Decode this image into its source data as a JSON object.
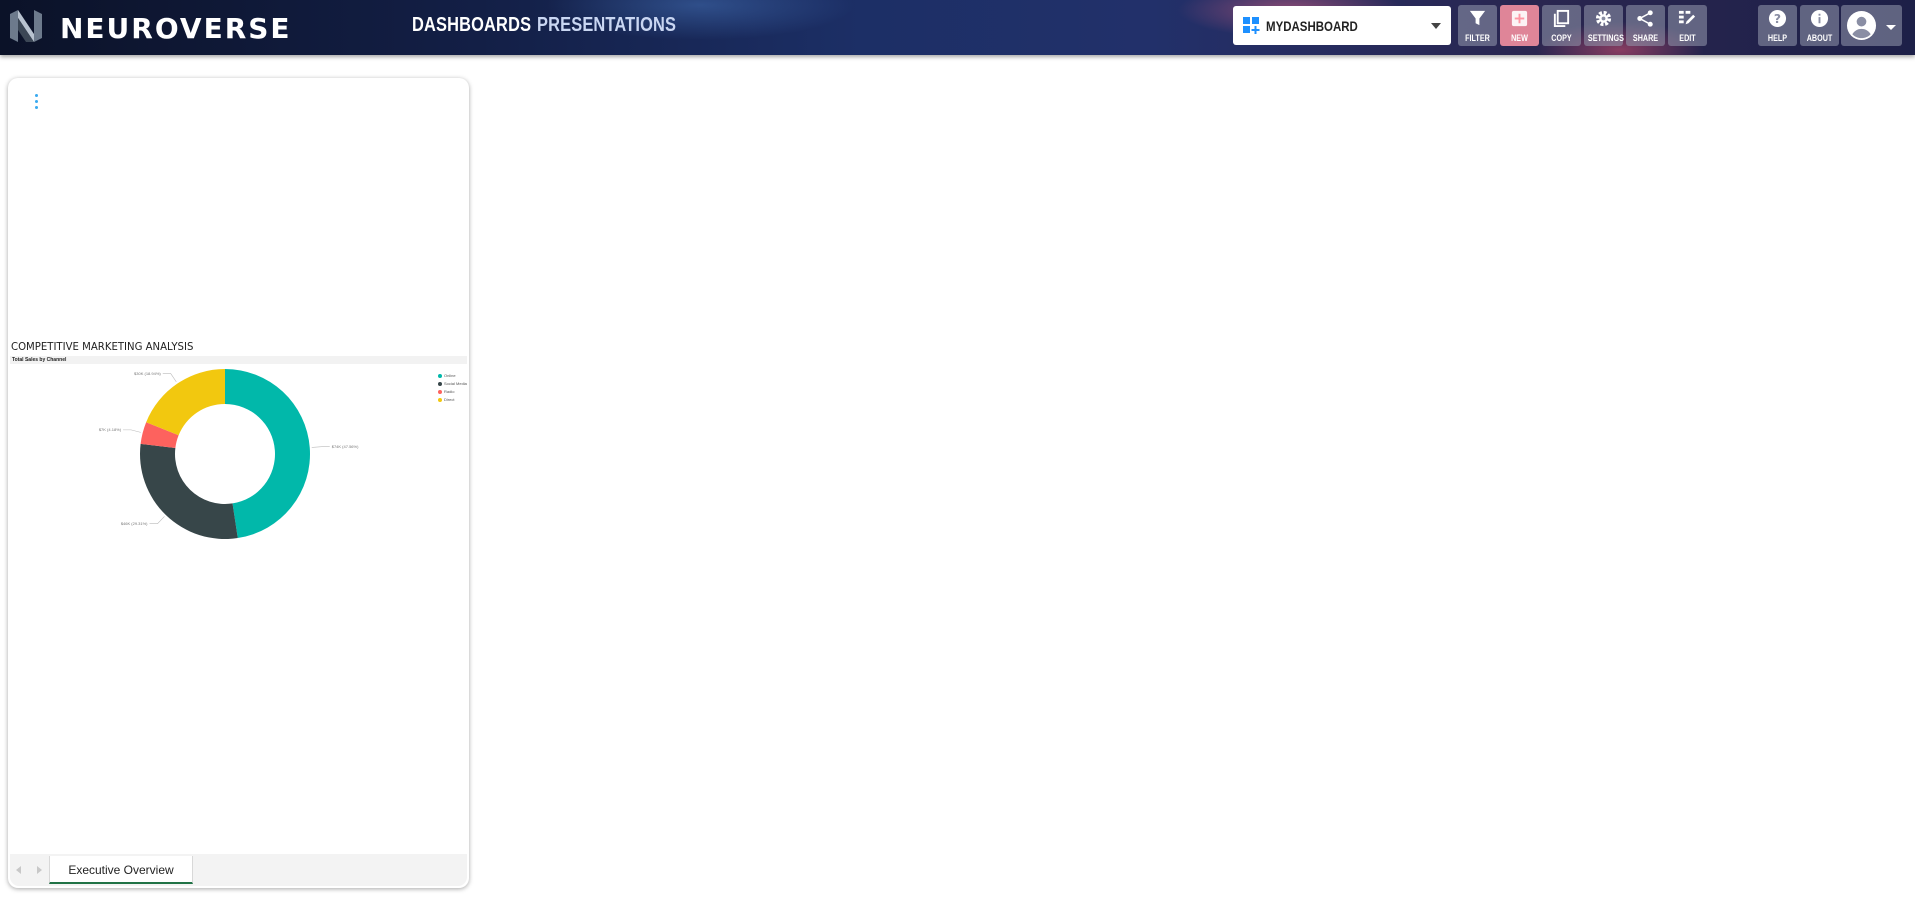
{
  "app": {
    "brand": "NEUROVERSE",
    "nav": {
      "dashboards": "DASHBOARDS",
      "presentations": "PRESENTATIONS"
    },
    "dashboard_select": {
      "value": "MYDASHBOARD"
    },
    "toolbar": {
      "filter": "FILTER",
      "new": "NEW",
      "copy": "COPY",
      "settings": "SETTINGS",
      "share": "SHARE",
      "edit": "EDIT",
      "help": "HELP",
      "about": "ABOUT"
    },
    "colors": {
      "accent": "#1e90ff",
      "new_button": "#ff96a5",
      "tab_underline": "#217346"
    }
  },
  "card": {
    "report_title": "COMPETITIVE MARKETING ANALYSIS",
    "visual_title": "Total Sales by Channel",
    "sheet_tab": "Executive Overview"
  },
  "chart_data": {
    "type": "pie",
    "title": "Total Sales by Channel",
    "donut": true,
    "categories": [
      "Online",
      "Social Media",
      "Radio",
      "Direct"
    ],
    "values": [
      47.6,
      29.3,
      4.2,
      18.9
    ],
    "labels": [
      "$74K (47.56%)",
      "$46K (29.31%)",
      "$7K (4.18%)",
      "$30K (18.94%)"
    ],
    "colors": [
      "#01b8aa",
      "#374649",
      "#fd625e",
      "#f2c80f"
    ],
    "legend": "right"
  }
}
